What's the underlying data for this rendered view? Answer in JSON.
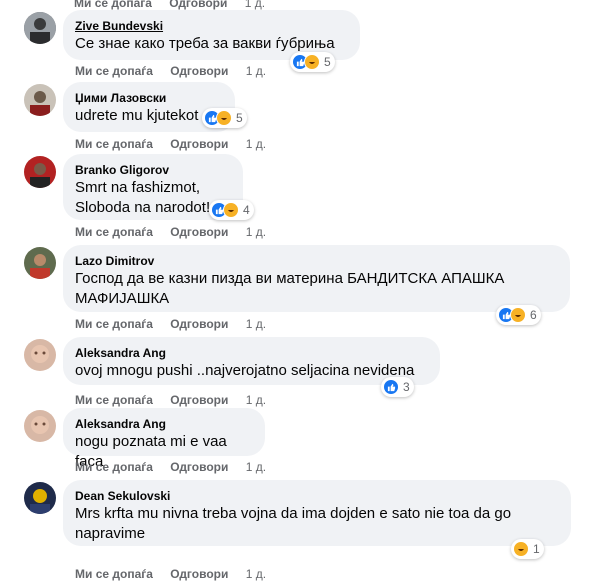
{
  "top_actions": {
    "like": "Ми се допаѓа",
    "reply": "Одговори",
    "time": "1 д."
  },
  "comments": [
    {
      "author": "Zive Bundevski",
      "text": "Се знае како треба за вакви ѓубриња",
      "like": "Ми се допаѓа",
      "reply": "Одговори",
      "time": "1 д.",
      "reactions": "5"
    },
    {
      "author": "Џими Лазовски",
      "text": "udrete mu kjutekot",
      "like": "Ми се допаѓа",
      "reply": "Одговори",
      "time": "1 д.",
      "reactions": "5"
    },
    {
      "author": "Branko Gligorov",
      "text": "Smrt na fashizmot,\nSloboda na narodot!",
      "like": "Ми се допаѓа",
      "reply": "Одговори",
      "time": "1 д.",
      "reactions": "4"
    },
    {
      "author": "Lazo Dimitrov",
      "text": "Господ да ве казни пизда ви материна БАНДИТСКА АПАШКА\nМАФИЈАШКА",
      "like": "Ми се допаѓа",
      "reply": "Одговори",
      "time": "1 д.",
      "reactions": "6"
    },
    {
      "author": "Aleksandra Ang",
      "text": "ovoj mnogu pushi ..najverojatno seljacina nevidena",
      "like": "Ми се допаѓа",
      "reply": "Одговори",
      "time": "1 д.",
      "reactions": "3"
    },
    {
      "author": "Aleksandra Ang",
      "text": "nogu poznata mi e vaa faca",
      "like": "Ми се допаѓа",
      "reply": "Одговори",
      "time": "1 д."
    },
    {
      "author": "Dean Sekulovski",
      "text": "Mrs krfta mu nivna treba vojna da ima dojden e sato nie toa da go\nnapravime",
      "like": "Ми се допаѓа",
      "reply": "Одговори",
      "time": "1 д.",
      "reactions": "1"
    }
  ]
}
